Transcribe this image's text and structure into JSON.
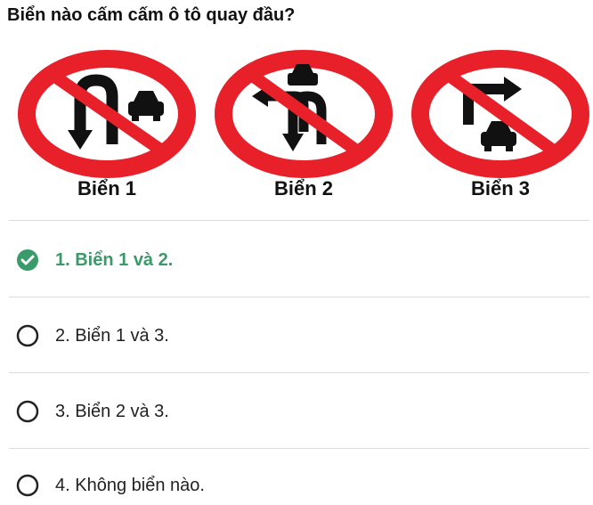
{
  "question": {
    "text": "Biển nào cấm cấm ô tô quay đầu?"
  },
  "signs": [
    {
      "label": "Biển 1",
      "icon": "no-u-turn-truck-sign-icon"
    },
    {
      "label": "Biển 2",
      "icon": "no-left-and-u-turn-sign-icon"
    },
    {
      "label": "Biển 3",
      "icon": "no-right-turn-car-sign-icon"
    }
  ],
  "options": [
    {
      "text": "1. Biển 1 và 2.",
      "state": "correct-selected",
      "icon": "check-circle-icon"
    },
    {
      "text": "2. Biển 1 và 3.",
      "state": "unselected",
      "icon": "radio-empty-icon"
    },
    {
      "text": "3. Biển 2 và 3.",
      "state": "unselected",
      "icon": "radio-empty-icon"
    },
    {
      "text": "4. Không biển nào.",
      "state": "unselected",
      "icon": "radio-empty-icon"
    }
  ],
  "colors": {
    "sign_red": "#e8202a",
    "correct_green": "#3a9a6a",
    "radio_outline": "#222222",
    "divider": "#dcdcdc"
  }
}
